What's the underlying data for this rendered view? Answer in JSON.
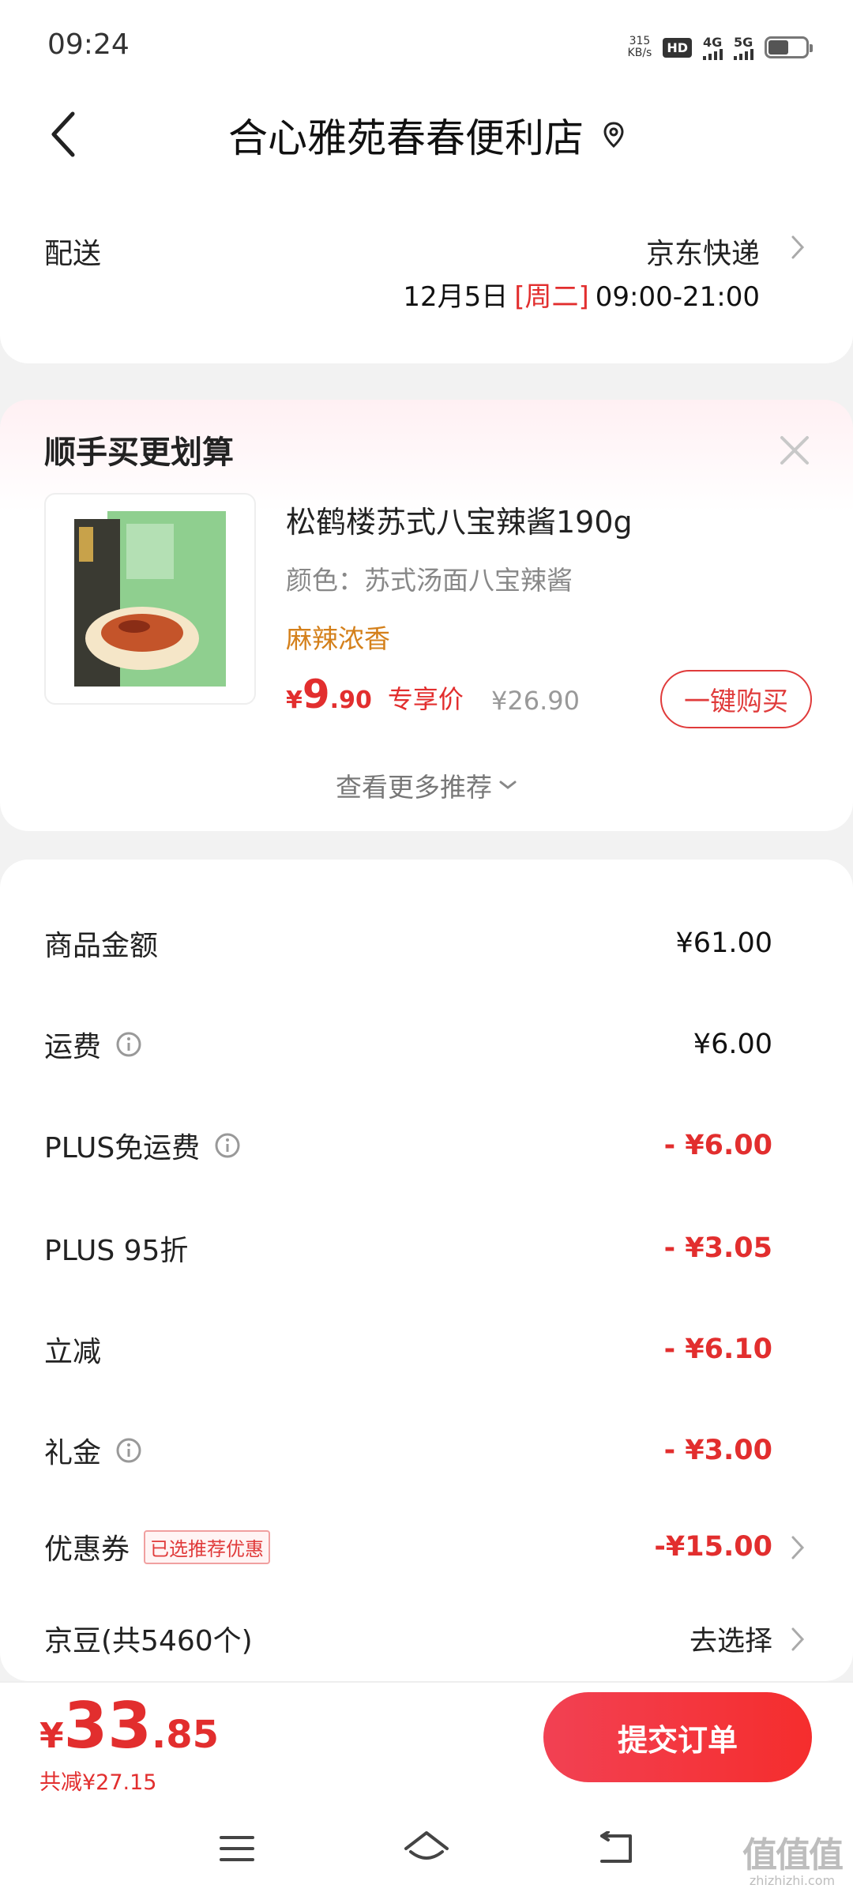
{
  "status_bar": {
    "time": "09:24",
    "net_speed_value": "315",
    "net_speed_unit": "KB/s",
    "hd_label": "HD",
    "sim1_label": "4G",
    "sim2_label": "5G"
  },
  "header": {
    "title": "合心雅苑春春便利店"
  },
  "delivery": {
    "label": "配送",
    "method": "京东快递",
    "date": "12月5日",
    "weekday": "[周二]",
    "time_range": "09:00-21:00"
  },
  "recommend": {
    "title": "顺手买更划算",
    "product": {
      "name": "松鹤楼苏式八宝辣酱190g",
      "spec": "颜色：苏式汤面八宝辣酱",
      "tag": "麻辣浓香",
      "price_symbol": "¥",
      "price_int": "9",
      "price_dec": ".90",
      "price_label": "专享价",
      "original_price": "¥26.90",
      "buy_label": "一键购买"
    },
    "more_label": "查看更多推荐"
  },
  "summary": {
    "rows": [
      {
        "label": "商品金额",
        "value": "¥61.00"
      },
      {
        "label": "运费",
        "value": "¥6.00"
      },
      {
        "label": "PLUS免运费",
        "value": "- ¥6.00"
      },
      {
        "label": "PLUS 95折",
        "value": "- ¥3.05"
      },
      {
        "label": "立减",
        "value": "- ¥6.10"
      },
      {
        "label": "礼金",
        "value": "- ¥3.00"
      },
      {
        "label": "优惠券",
        "badge": "已选推荐优惠",
        "value": "-¥15.00"
      },
      {
        "label": "京豆(共5460个)",
        "value": "去选择"
      }
    ]
  },
  "footer": {
    "total_symbol": "¥",
    "total_int": "33",
    "total_dec": ".85",
    "total_saved": "共减¥27.15",
    "submit_label": "提交订单"
  },
  "watermark": {
    "mark": "值值值",
    "url": "zhizhizhi.com"
  },
  "colors": {
    "accent_red": "#e22e2e",
    "tag_orange": "#d4801b"
  },
  "icons": [
    "back-arrow-icon",
    "location-pin-icon",
    "chevron-right-icon",
    "close-icon",
    "info-icon",
    "chevron-down-icon",
    "menu-icon",
    "home-icon",
    "back-icon"
  ]
}
